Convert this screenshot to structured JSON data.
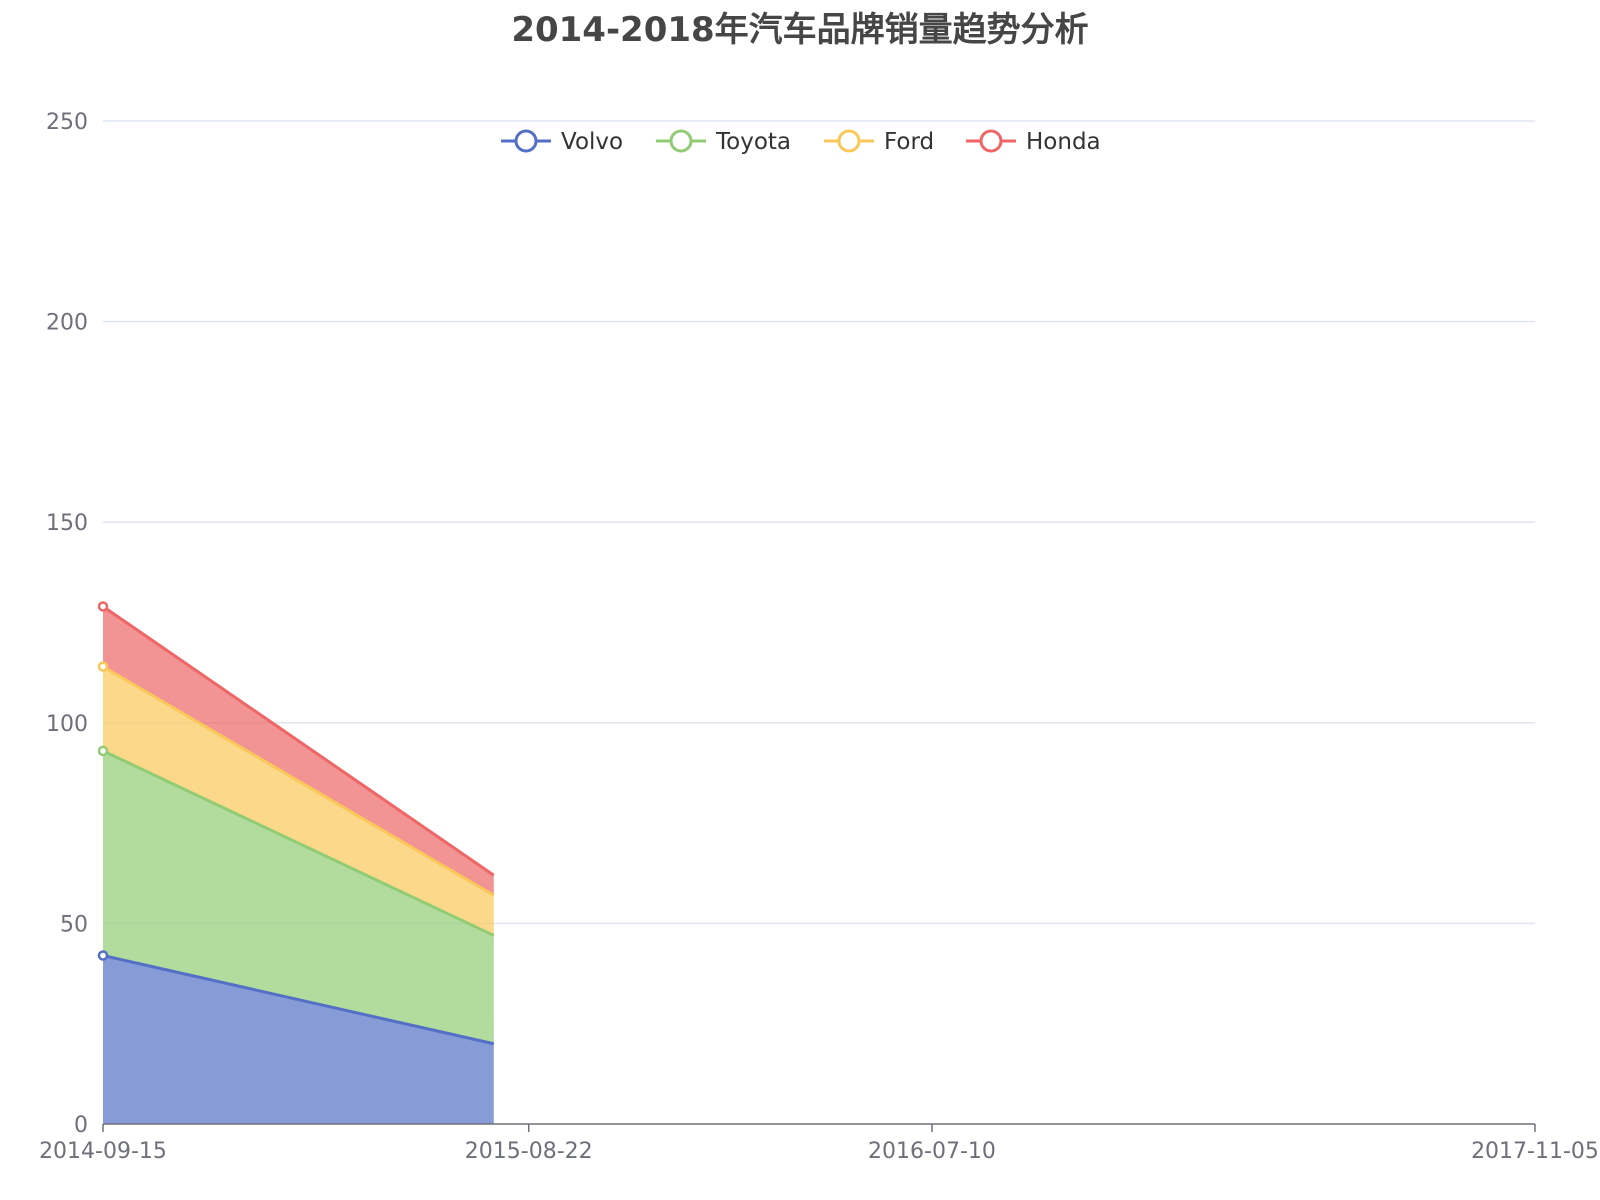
{
  "chart_data": {
    "type": "area",
    "stacked": true,
    "title": "2014-2018年汽车品牌销量趋势分析",
    "x_tick_labels": [
      "2014-09-15",
      "2015-08-22",
      "2016-07-10",
      "2017-11-05"
    ],
    "x_range": [
      "2014-09-15",
      "2017-11-05"
    ],
    "x": [
      "2014-09-15",
      "2015-07-25"
    ],
    "ylim": [
      0,
      250
    ],
    "y_ticks": [
      "0",
      "50",
      "100",
      "150",
      "200",
      "250"
    ],
    "grid": true,
    "legend_position": "top-center",
    "series": [
      {
        "name": "Volvo",
        "color": "#5470c6",
        "values": [
          42,
          20
        ]
      },
      {
        "name": "Toyota",
        "color": "#91cc75",
        "values": [
          51,
          27
        ]
      },
      {
        "name": "Ford",
        "color": "#fac858",
        "values": [
          21,
          10
        ]
      },
      {
        "name": "Honda",
        "color": "#ee6666",
        "values": [
          15,
          5
        ]
      }
    ]
  }
}
